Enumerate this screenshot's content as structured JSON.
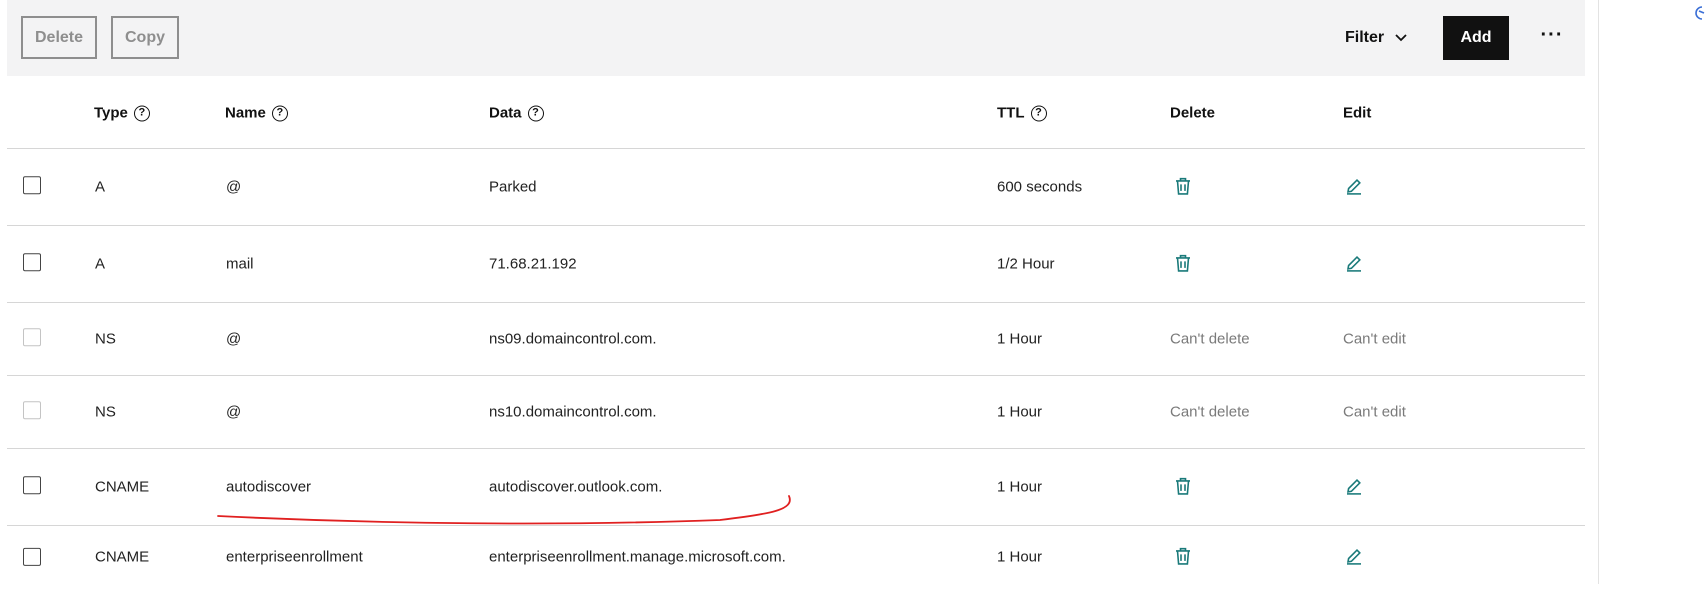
{
  "toolbar": {
    "delete_label": "Delete",
    "copy_label": "Copy",
    "filter_label": "Filter",
    "add_label": "Add",
    "more_label": "···"
  },
  "table": {
    "headers": {
      "type": "Type",
      "name": "Name",
      "data": "Data",
      "ttl": "TTL",
      "delete": "Delete",
      "edit": "Edit"
    },
    "rows": [
      {
        "type": "A",
        "name": "@",
        "data": "Parked",
        "ttl": "600 seconds",
        "delete": "",
        "edit": "",
        "locked": false
      },
      {
        "type": "A",
        "name": "mail",
        "data": "71.68.21.192",
        "ttl": "1/2 Hour",
        "delete": "",
        "edit": "",
        "locked": false
      },
      {
        "type": "NS",
        "name": "@",
        "data": "ns09.domaincontrol.com.",
        "ttl": "1 Hour",
        "delete": "Can't delete",
        "edit": "Can't edit",
        "locked": true
      },
      {
        "type": "NS",
        "name": "@",
        "data": "ns10.domaincontrol.com.",
        "ttl": "1 Hour",
        "delete": "Can't delete",
        "edit": "Can't edit",
        "locked": true
      },
      {
        "type": "CNAME",
        "name": "autodiscover",
        "data": "autodiscover.outlook.com.",
        "ttl": "1 Hour",
        "delete": "",
        "edit": "",
        "locked": false
      },
      {
        "type": "CNAME",
        "name": "enterpriseenrollment",
        "data": "enterpriseenrollment.manage.microsoft.com.",
        "ttl": "1 Hour",
        "delete": "",
        "edit": "",
        "locked": false
      }
    ]
  },
  "icons": {
    "help": "question-circle-icon",
    "delete": "trash-icon",
    "edit": "pencil-icon",
    "filter": "chevron-down-icon",
    "more": "ellipsis-icon"
  },
  "colors": {
    "accent": "#1a7a7a",
    "annotation": "#e02020",
    "toolbar_bg": "#f3f3f4",
    "muted_text": "#7a7a7a"
  }
}
